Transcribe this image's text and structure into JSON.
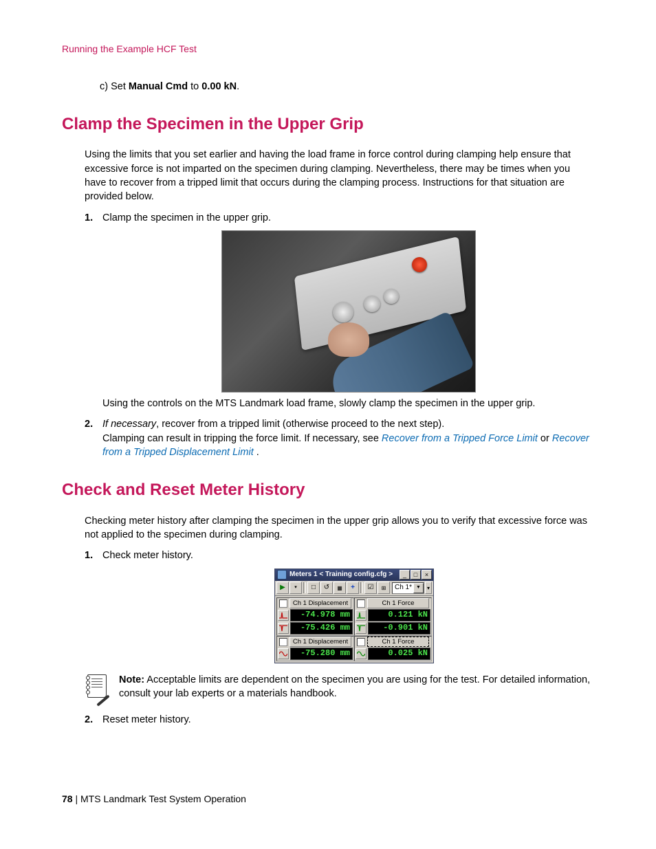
{
  "running_header": "Running the Example HCF Test",
  "substep": {
    "letter": "c)",
    "before": "Set ",
    "bold1": "Manual Cmd",
    "mid": " to ",
    "bold2": "0.00 kN",
    "after": "."
  },
  "section1": {
    "heading": "Clamp the Specimen in the Upper Grip",
    "intro": "Using the limits that you set earlier and having the load frame in force control during clamping help ensure that excessive force is not imparted on the specimen during clamping. Nevertheless, there may be times when you have to recover from a tripped limit that occurs during the clamping process. Instructions for that situation are provided below.",
    "steps": [
      {
        "num": "1.",
        "text": "Clamp the specimen in the upper grip.",
        "caption": "Using the controls on the MTS Landmark load frame, slowly clamp the specimen in the upper grip."
      },
      {
        "num": "2.",
        "lead_italic": "If necessary",
        "lead_rest": ", recover from a tripped limit (otherwise proceed to the next step).",
        "line2_a": "Clamping can result in tripping the force limit. If necessary, see ",
        "link1": "Recover from a Tripped Force Limit",
        "line2_b": " or ",
        "link2": "Recover from a Tripped Displacement Limit",
        "line2_c": " ."
      }
    ]
  },
  "section2": {
    "heading": "Check and Reset Meter History",
    "intro": "Checking meter history after clamping the specimen in the upper grip allows you to verify that excessive force was not applied to the specimen during clamping.",
    "steps": [
      {
        "num": "1.",
        "text": "Check meter history."
      },
      {
        "num": "2.",
        "text": "Reset meter history."
      }
    ],
    "note_label": "Note:",
    "note_text": "  Acceptable limits are dependent on the specimen you are using for the test. For detailed information, consult your lab experts or a materials handbook."
  },
  "meters": {
    "title": "Meters 1 < Training config.cfg >",
    "combo": "Ch 1*",
    "panels": {
      "topLeft": {
        "label": "Ch 1 Displacement",
        "rows": [
          {
            "wave": "red-peak-up",
            "value": "-74.978 mm"
          },
          {
            "wave": "red-peak-dn",
            "value": "-75.426 mm"
          }
        ]
      },
      "topRight": {
        "label": "Ch 1 Force",
        "rows": [
          {
            "wave": "grn-peak-up",
            "value": "0.121 kN"
          },
          {
            "wave": "grn-peak-dn",
            "value": "-0.901 kN"
          }
        ]
      },
      "botLeft": {
        "label": "Ch 1 Displacement",
        "rows": [
          {
            "wave": "red-sine",
            "value": "-75.280 mm"
          }
        ]
      },
      "botRight": {
        "label": "Ch 1 Force",
        "label_dashed": true,
        "rows": [
          {
            "wave": "grn-sine",
            "value": "0.025 kN"
          }
        ]
      }
    }
  },
  "footer": {
    "page": "78",
    "sep": " | ",
    "title": "MTS Landmark Test System Operation"
  }
}
